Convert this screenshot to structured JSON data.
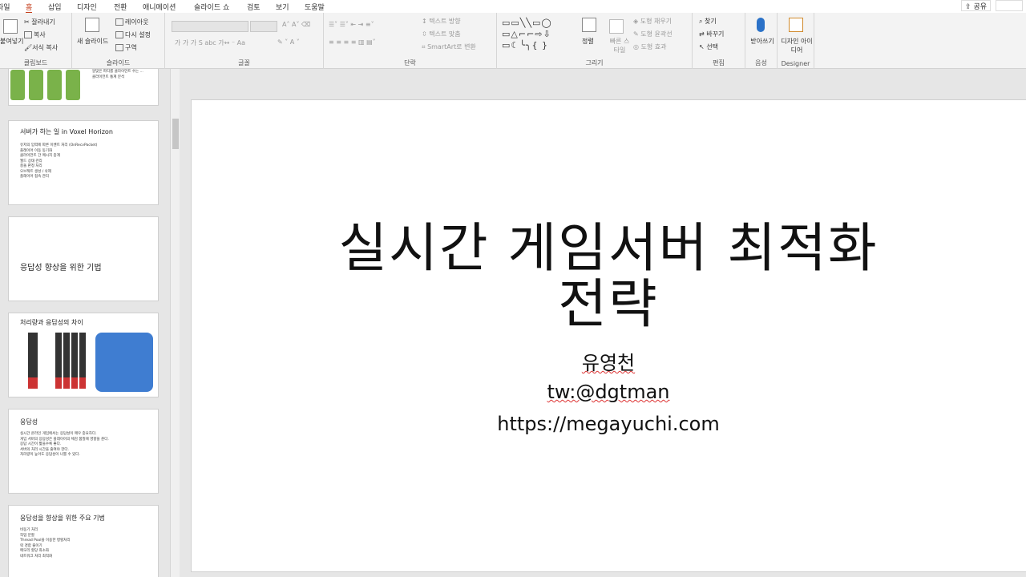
{
  "menu": {
    "tabs": [
      "파일",
      "홈",
      "삽입",
      "디자인",
      "전환",
      "애니메이션",
      "슬라이드 쇼",
      "검토",
      "보기",
      "도움말"
    ],
    "active_tab": "홈",
    "share": "공유"
  },
  "ribbon": {
    "clipboard": {
      "label": "클립보드",
      "paste": "붙여넣기",
      "cut": "잘라내기",
      "copy": "복사",
      "format_painter": "서식 복사"
    },
    "slides": {
      "label": "슬라이드",
      "new_slide": "새 슬라이드",
      "layout": "레이아웃",
      "reset": "다시 설정",
      "section": "구역"
    },
    "font": {
      "label": "글꼴"
    },
    "paragraph": {
      "label": "단락",
      "text_direction": "텍스트 방향",
      "align_text": "텍스트 맞춤",
      "smartart": "SmartArt로 변환"
    },
    "drawing": {
      "label": "그리기",
      "arrange": "정렬",
      "quick_styles": "빠른 스타일",
      "shape_fill": "도형 채우기",
      "shape_outline": "도형 윤곽선",
      "shape_effects": "도형 효과"
    },
    "editing": {
      "label": "편집",
      "find": "찾기",
      "replace": "바꾸기",
      "select": "선택"
    },
    "voice": {
      "label": "음성",
      "dictate": "받아쓰기"
    },
    "designer": {
      "label": "Designer",
      "design_ideas": "디자인 아이디어"
    }
  },
  "thumbnails": [
    {
      "title": "",
      "bullets": [
        "알맞은 파티를 클라이언트 수는 ...",
        "클라이언트 통계 분석"
      ]
    },
    {
      "title": "서버가 하는 일 in Voxel Horizon",
      "bullets": [
        "유저의 입력에 따른 이벤트 처리 (OnRecvPacket)",
        "플레이어 이동 동기화",
        "클라이언트 간 메시지 중계",
        "월드 상태 관리",
        "충돌 판정 처리",
        "오브젝트 생성 / 삭제",
        "플레이어 접속 관리"
      ]
    },
    {
      "title": "응답성 향상을 위한 기법",
      "bullets": []
    },
    {
      "title": "처리량과 응답성의 차이",
      "bullets": []
    },
    {
      "title": "응답성",
      "bullets": [
        "실시간 온라인 게임에서는 응답성이 매우 중요하다.",
        "게임 서버의 응답성은 플레이어의 체감 품질에 영향을 준다.",
        "응답 시간이 짧을수록 좋다.",
        "서버의 처리 시간을 줄여야 한다.",
        "처리량이 높아도 응답성이 나쁠 수 있다."
      ]
    },
    {
      "title": "응답성을 향상을 위한 주요 기법",
      "bullets": [
        "비동기 처리",
        "작업 분할",
        "Thread Pool을 이용한 병렬처리",
        "락 경합 줄이기",
        "메모리 할당 최소화",
        "네트워크 처리 최적화"
      ]
    }
  ],
  "slide": {
    "title_line1": "실시간 게임서버 최적화",
    "title_line2": "전략",
    "author": "유영천",
    "twitter": "tw:@dgtman",
    "url": "https://megayuchi.com"
  },
  "colors": {
    "accent": "#c43e1c",
    "slide_bg": "#ffffff",
    "app_bg": "#e6e6e6"
  }
}
